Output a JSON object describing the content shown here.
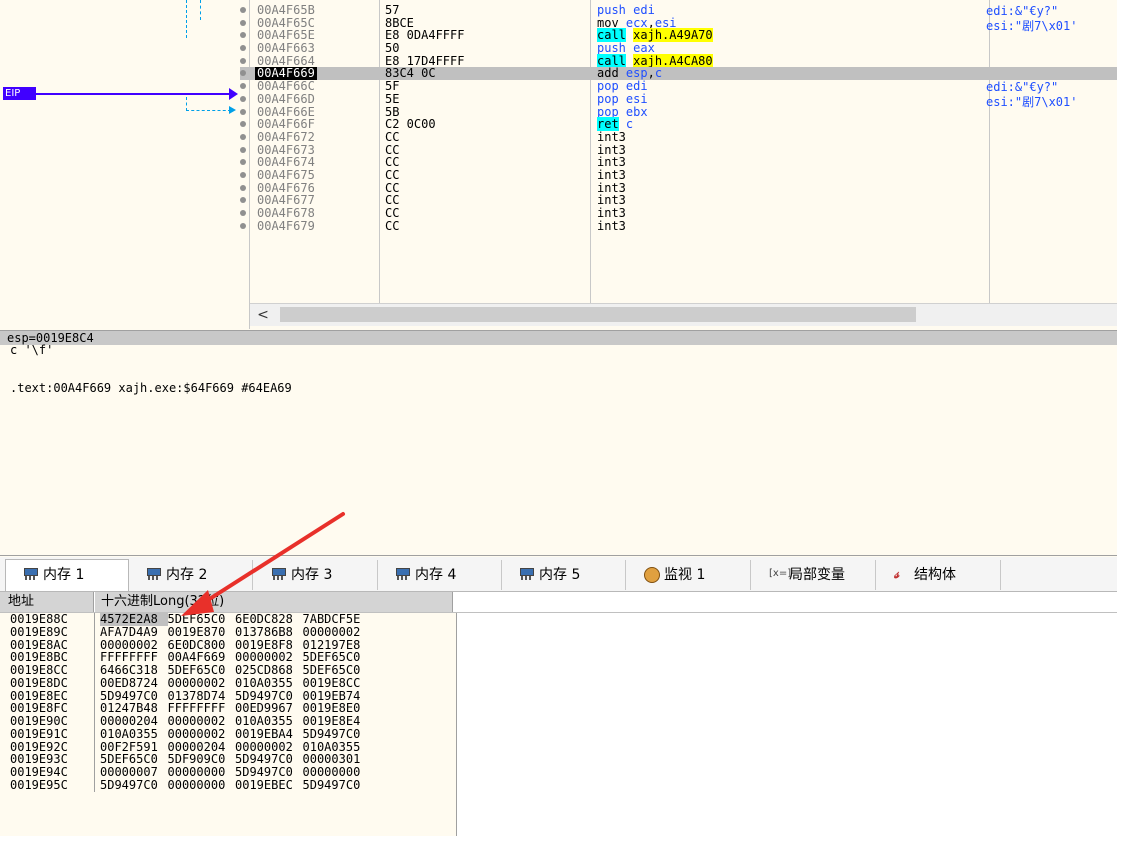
{
  "disasm": {
    "eip_label": "EIP",
    "rows": [
      {
        "addr": "00A4F65B",
        "bytes": "57",
        "mn": "push",
        "mnc": "mn-push",
        "ops": [
          {
            "t": "edi",
            "c": "op-reg"
          }
        ],
        "current": false
      },
      {
        "addr": "00A4F65C",
        "bytes": "8BCE",
        "mn": "mov",
        "mnc": "mn",
        "ops": [
          {
            "t": "ecx",
            "c": "op-reg"
          },
          {
            "t": ",",
            "c": "op-imm"
          },
          {
            "t": "esi",
            "c": "op-reg"
          }
        ],
        "current": false
      },
      {
        "addr": "00A4F65E",
        "bytes": "E8 0DA4FFFF",
        "mn": "call",
        "mnc": "mn-call",
        "ops": [
          {
            "t": "xajh.A49A70",
            "c": "op-sym"
          }
        ],
        "current": false
      },
      {
        "addr": "00A4F663",
        "bytes": "50",
        "mn": "push",
        "mnc": "mn-push",
        "ops": [
          {
            "t": "eax",
            "c": "op-reg"
          }
        ],
        "current": false
      },
      {
        "addr": "00A4F664",
        "bytes": "E8 17D4FFFF",
        "mn": "call",
        "mnc": "mn-call",
        "ops": [
          {
            "t": "xajh.A4CA80",
            "c": "op-sym"
          }
        ],
        "current": false
      },
      {
        "addr": "00A4F669",
        "bytes": "83C4 0C",
        "mn": "add",
        "mnc": "mn",
        "ops": [
          {
            "t": "esp",
            "c": "op-reg"
          },
          {
            "t": ",",
            "c": "op-imm"
          },
          {
            "t": "c",
            "c": "op-reg"
          }
        ],
        "current": true
      },
      {
        "addr": "00A4F66C",
        "bytes": "5F",
        "mn": "pop",
        "mnc": "mn-pop",
        "ops": [
          {
            "t": "edi",
            "c": "op-reg"
          }
        ],
        "current": false
      },
      {
        "addr": "00A4F66D",
        "bytes": "5E",
        "mn": "pop",
        "mnc": "mn-pop",
        "ops": [
          {
            "t": "esi",
            "c": "op-reg"
          }
        ],
        "current": false
      },
      {
        "addr": "00A4F66E",
        "bytes": "5B",
        "mn": "pop",
        "mnc": "mn-pop",
        "ops": [
          {
            "t": "ebx",
            "c": "op-reg"
          }
        ],
        "current": false
      },
      {
        "addr": "00A4F66F",
        "bytes": "C2 0C00",
        "mn": "ret",
        "mnc": "mn-ret",
        "ops": [
          {
            "t": "c",
            "c": "op-reg"
          }
        ],
        "current": false
      },
      {
        "addr": "00A4F672",
        "bytes": "CC",
        "mn": "int3",
        "mnc": "mn",
        "ops": [],
        "current": false
      },
      {
        "addr": "00A4F673",
        "bytes": "CC",
        "mn": "int3",
        "mnc": "mn",
        "ops": [],
        "current": false
      },
      {
        "addr": "00A4F674",
        "bytes": "CC",
        "mn": "int3",
        "mnc": "mn",
        "ops": [],
        "current": false
      },
      {
        "addr": "00A4F675",
        "bytes": "CC",
        "mn": "int3",
        "mnc": "mn",
        "ops": [],
        "current": false
      },
      {
        "addr": "00A4F676",
        "bytes": "CC",
        "mn": "int3",
        "mnc": "mn",
        "ops": [],
        "current": false
      },
      {
        "addr": "00A4F677",
        "bytes": "CC",
        "mn": "int3",
        "mnc": "mn",
        "ops": [],
        "current": false
      },
      {
        "addr": "00A4F678",
        "bytes": "CC",
        "mn": "int3",
        "mnc": "mn",
        "ops": [],
        "current": false
      },
      {
        "addr": "00A4F679",
        "bytes": "CC",
        "mn": "int3",
        "mnc": "mn",
        "ops": [],
        "current": false
      }
    ],
    "comments": [
      {
        "text": "edi:&\"€y?\"",
        "row": 0
      },
      {
        "text": "esi:\"剧7\\x01'",
        "row": 1
      },
      {
        "text": "edi:&\"€y?\"",
        "row": 6
      },
      {
        "text": "esi:\"剧7\\x01'",
        "row": 7
      }
    ],
    "scroll_left": "<"
  },
  "info": {
    "esp_line": "esp=0019E8C4",
    "char_line": "c '\\f'",
    "text_line": ".text:00A4F669 xajh.exe:$64F669 #64EA69"
  },
  "tabs": [
    {
      "label": "内存 1",
      "icon": "memory-icon",
      "active": true
    },
    {
      "label": "内存 2",
      "icon": "memory-icon",
      "active": false
    },
    {
      "label": "内存 3",
      "icon": "memory-icon",
      "active": false
    },
    {
      "label": "内存 4",
      "icon": "memory-icon",
      "active": false
    },
    {
      "label": "内存 5",
      "icon": "memory-icon",
      "active": false
    },
    {
      "label": "监视 1",
      "icon": "watch-icon",
      "active": false
    },
    {
      "label": "局部变量",
      "icon": "local-vars-icon",
      "active": false
    },
    {
      "label": "结构体",
      "icon": "struct-icon",
      "active": false
    }
  ],
  "dump": {
    "col_address": "地址",
    "col_hex": "十六进制Long(32位)",
    "rows": [
      {
        "addr": "0019E88C",
        "v": [
          "4572E2A8",
          "5DEF65C0",
          "6E0DC828",
          "7ABDCF5E"
        ],
        "sel": 0
      },
      {
        "addr": "0019E89C",
        "v": [
          "AFA7D4A9",
          "0019E870",
          "013786B8",
          "00000002"
        ],
        "sel": -1
      },
      {
        "addr": "0019E8AC",
        "v": [
          "00000002",
          "6E0DC800",
          "0019E8F8",
          "012197E8"
        ],
        "sel": -1
      },
      {
        "addr": "0019E8BC",
        "v": [
          "FFFFFFFF",
          "00A4F669",
          "00000002",
          "5DEF65C0"
        ],
        "sel": -1
      },
      {
        "addr": "0019E8CC",
        "v": [
          "6466C318",
          "5DEF65C0",
          "025CD868",
          "5DEF65C0"
        ],
        "sel": -1
      },
      {
        "addr": "0019E8DC",
        "v": [
          "00ED8724",
          "00000002",
          "010A0355",
          "0019E8CC"
        ],
        "sel": -1
      },
      {
        "addr": "0019E8EC",
        "v": [
          "5D9497C0",
          "01378D74",
          "5D9497C0",
          "0019EB74"
        ],
        "sel": -1
      },
      {
        "addr": "0019E8FC",
        "v": [
          "01247B48",
          "FFFFFFFF",
          "00ED9967",
          "0019E8E0"
        ],
        "sel": -1
      },
      {
        "addr": "0019E90C",
        "v": [
          "00000204",
          "00000002",
          "010A0355",
          "0019E8E4"
        ],
        "sel": -1
      },
      {
        "addr": "0019E91C",
        "v": [
          "010A0355",
          "00000002",
          "0019EBA4",
          "5D9497C0"
        ],
        "sel": -1
      },
      {
        "addr": "0019E92C",
        "v": [
          "00F2F591",
          "00000204",
          "00000002",
          "010A0355"
        ],
        "sel": -1
      },
      {
        "addr": "0019E93C",
        "v": [
          "5DEF65C0",
          "5DF909C0",
          "5D9497C0",
          "00000301"
        ],
        "sel": -1
      },
      {
        "addr": "0019E94C",
        "v": [
          "00000007",
          "00000000",
          "5D9497C0",
          "00000000"
        ],
        "sel": -1
      },
      {
        "addr": "0019E95C",
        "v": [
          "5D9497C0",
          "00000000",
          "0019EBEC",
          "5D9497C0"
        ],
        "sel": -1
      }
    ]
  },
  "colors": {
    "annotation_arrow": "#e8302a",
    "eip": "#4000ff",
    "jump": "#00a0e8",
    "call_highlight": "#00ffff",
    "symbol_highlight": "#ffff00"
  }
}
